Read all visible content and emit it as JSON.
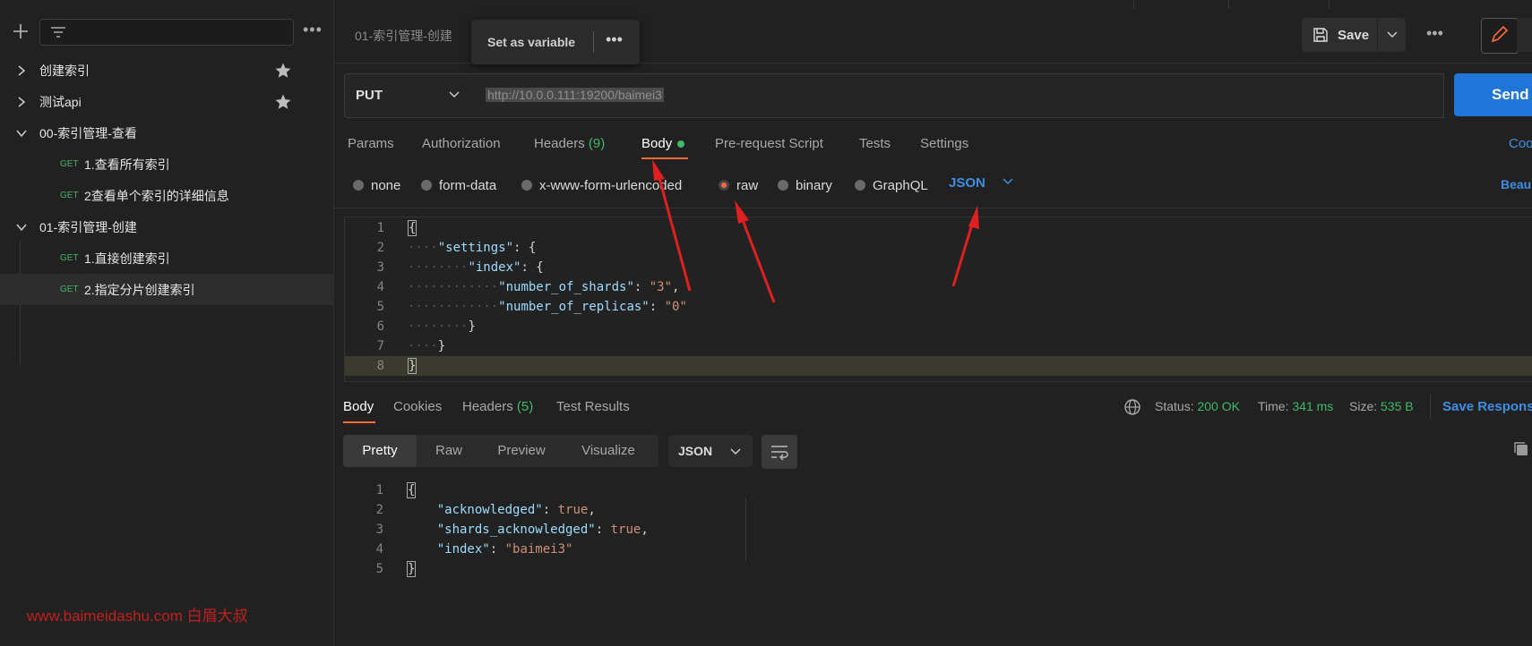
{
  "sidebar": {
    "items": [
      {
        "label": "创建索引",
        "type": "folder",
        "starred": true
      },
      {
        "label": "测试api",
        "type": "folder",
        "starred": true
      },
      {
        "label": "00-索引管理-查看",
        "type": "folder-open"
      },
      {
        "method": "GET",
        "label": "1.查看所有索引",
        "type": "request"
      },
      {
        "method": "GET",
        "label": "2查看单个索引的详细信息",
        "type": "request"
      },
      {
        "label": "01-索引管理-创建",
        "type": "folder-open"
      },
      {
        "method": "GET",
        "label": "1.直接创建索引",
        "type": "request"
      },
      {
        "method": "GET",
        "label": "2.指定分片创建索引",
        "type": "request",
        "selected": true
      }
    ],
    "more": "•••",
    "watermark": "www.baimeidashu.com 白眉大叔"
  },
  "topbar": {
    "request_title": "01-索引管理-创建",
    "tooltip_label": "Set as variable",
    "tooltip_more": "•••",
    "save_label": "Save",
    "more": "•••"
  },
  "request": {
    "method": "PUT",
    "url": "http://10.0.0.111:19200/baimei3",
    "send_label": "Send"
  },
  "request_tabs": {
    "params": "Params",
    "authorization": "Authorization",
    "headers": "Headers",
    "headers_count": "(9)",
    "body": "Body",
    "prerequest": "Pre-request Script",
    "tests": "Tests",
    "settings": "Settings",
    "cookies": "Coo"
  },
  "body_types": {
    "none": "none",
    "form_data": "form-data",
    "urlencoded": "x-www-form-urlencoded",
    "raw": "raw",
    "binary": "binary",
    "graphql": "GraphQL",
    "format": "JSON",
    "beautify": "Beau"
  },
  "request_body_lines": [
    "{",
    "\"settings\": {",
    "\"index\": {",
    "\"number_of_shards\": \"3\",",
    "\"number_of_replicas\": \"0\"",
    "}",
    "}",
    "}"
  ],
  "response_tabs": {
    "body": "Body",
    "cookies": "Cookies",
    "headers": "Headers",
    "headers_count": "(5)",
    "test_results": "Test Results"
  },
  "response_status": {
    "status_label": "Status:",
    "status_value": "200 OK",
    "time_label": "Time:",
    "time_value": "341 ms",
    "size_label": "Size:",
    "size_value": "535 B",
    "save_response": "Save Respons"
  },
  "response_view": {
    "pretty": "Pretty",
    "raw": "Raw",
    "preview": "Preview",
    "visualize": "Visualize",
    "format": "JSON"
  },
  "response_body": {
    "acknowledged_key": "\"acknowledged\"",
    "acknowledged_val": "true",
    "shards_key": "\"shards_acknowledged\"",
    "shards_val": "true",
    "index_key": "\"index\"",
    "index_val": "\"baimei3\""
  },
  "colors": {
    "accent": "#ff6c37",
    "send": "#1f75d8",
    "get": "#48b36a",
    "link": "#3f8ee3",
    "annotation_arrow": "#e02020"
  }
}
